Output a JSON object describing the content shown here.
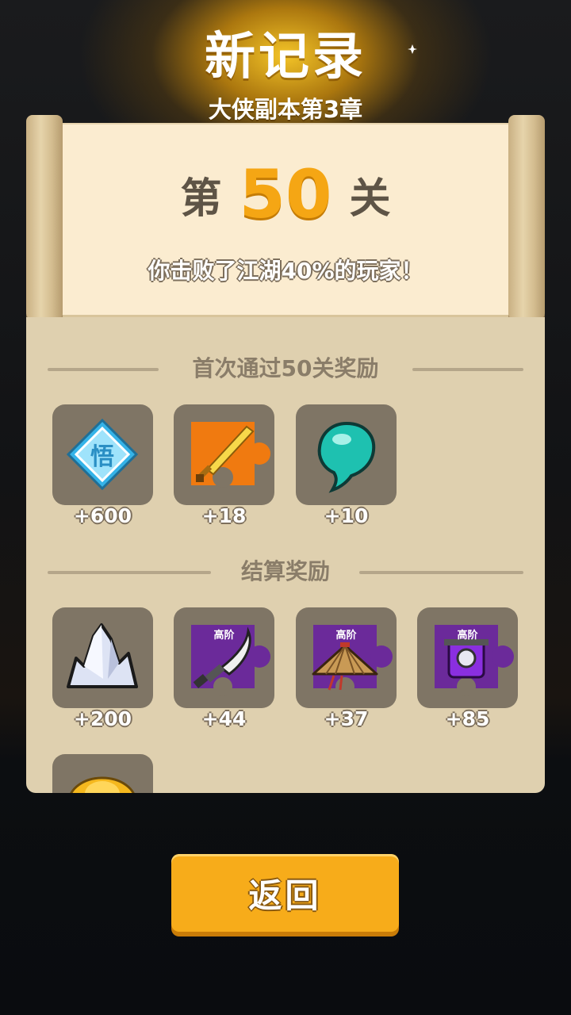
{
  "header": {
    "title": "新记录",
    "subtitle": "大侠副本第3章"
  },
  "stage": {
    "prefix": "第",
    "number": "50",
    "suffix": "关",
    "defeat_text": "你击败了江湖40%的玩家！"
  },
  "first_clear": {
    "heading": "首次通过50关奖励",
    "items": [
      {
        "icon": "enlightenment-crystal-icon",
        "qty": "+600"
      },
      {
        "icon": "golden-sword-fragment-icon",
        "qty": "+18"
      },
      {
        "icon": "jade-bead-icon",
        "qty": "+10"
      }
    ]
  },
  "settlement": {
    "heading": "结算奖励",
    "items": [
      {
        "icon": "silver-crystal-icon",
        "qty": "+200"
      },
      {
        "icon": "broadsword-fragment-icon",
        "qty": "+44",
        "tier": "高阶"
      },
      {
        "icon": "bamboo-hat-fragment-icon",
        "qty": "+37",
        "tier": "高阶"
      },
      {
        "icon": "purple-armor-fragment-icon",
        "qty": "+85",
        "tier": "高阶"
      },
      {
        "icon": "gold-ingot-icon"
      }
    ]
  },
  "colors": {
    "accent": "#f5a614",
    "panel": "#dfd0af",
    "slot": "#7f7565",
    "button": "#f7ac1a"
  },
  "buttons": {
    "back": "返回"
  }
}
